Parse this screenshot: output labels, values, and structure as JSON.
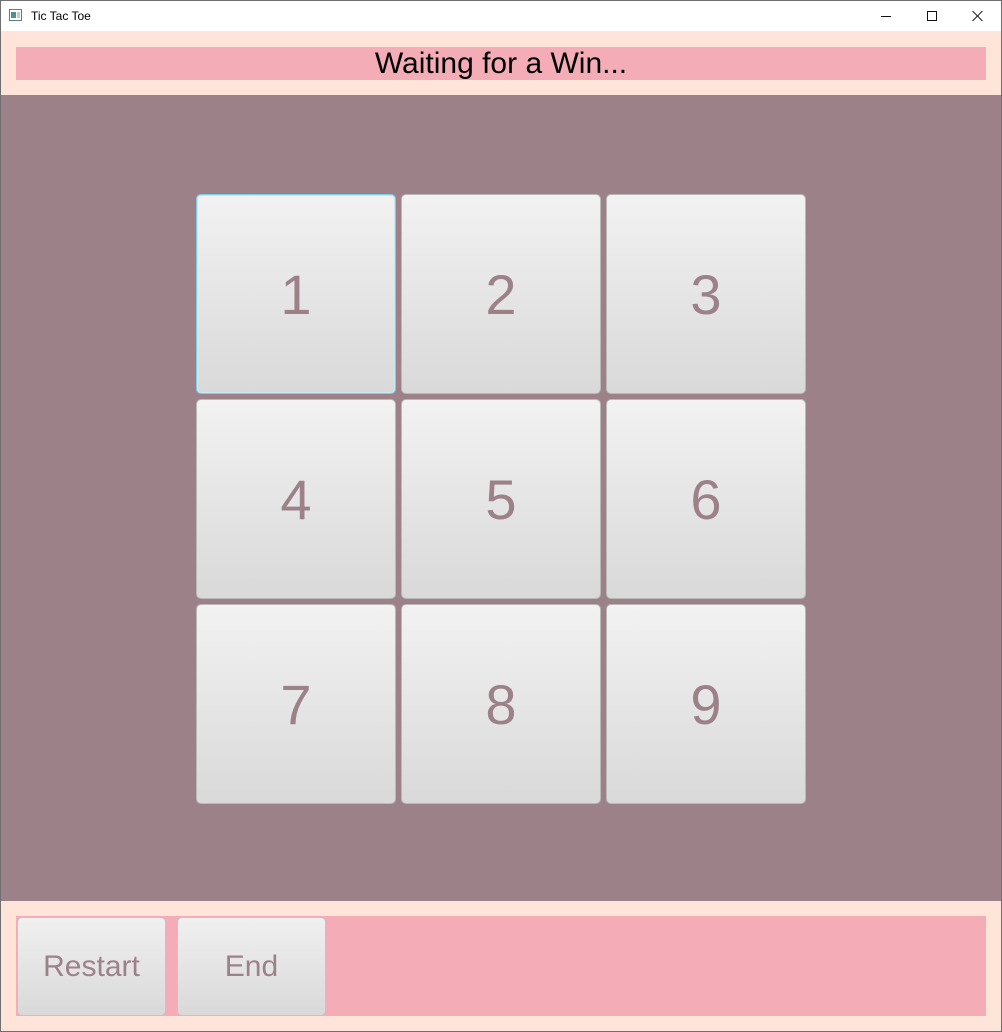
{
  "window": {
    "title": "Tic Tac Toe",
    "controls": {
      "minimize": "minimize-icon",
      "maximize": "maximize-icon",
      "close": "close-icon"
    }
  },
  "status": {
    "text": "Waiting for a Win..."
  },
  "board": {
    "cells": [
      "1",
      "2",
      "3",
      "4",
      "5",
      "6",
      "7",
      "8",
      "9"
    ],
    "focused_cell": "1"
  },
  "footer": {
    "restart_label": "Restart",
    "end_label": "End"
  },
  "colors": {
    "outer_background": "#ffe4d9",
    "status_background": "#f4acb7",
    "board_background": "#9d8189",
    "cell_text": "#9d8189",
    "focus_border": "#7fcde8"
  }
}
